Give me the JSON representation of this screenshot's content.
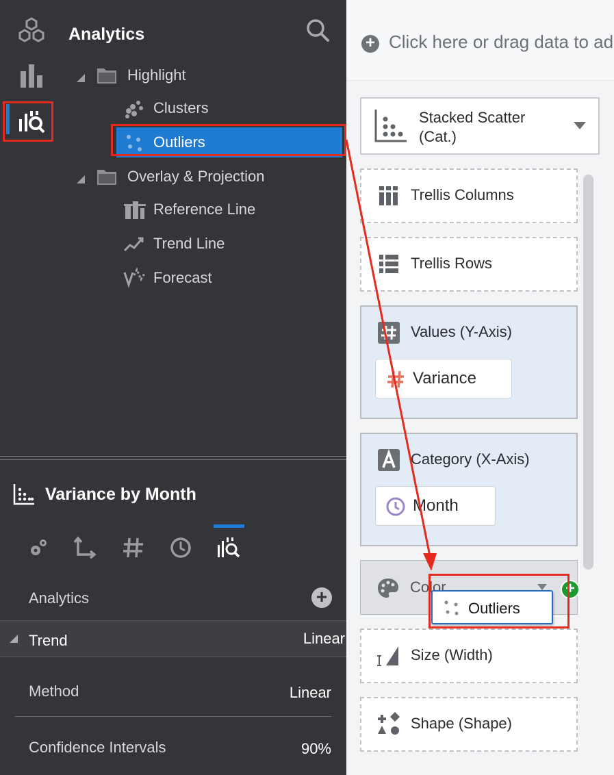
{
  "analytics_panel": {
    "title": "Analytics",
    "tree": [
      {
        "label": "Highlight",
        "type": "folder"
      },
      {
        "label": "Clusters",
        "type": "item"
      },
      {
        "label": "Outliers",
        "type": "item",
        "selected": true
      },
      {
        "label": "Overlay & Projection",
        "type": "folder"
      },
      {
        "label": "Reference Line",
        "type": "item"
      },
      {
        "label": "Trend Line",
        "type": "item"
      },
      {
        "label": "Forecast",
        "type": "item"
      }
    ]
  },
  "properties": {
    "viz_title": "Variance by Month",
    "section_label": "Analytics",
    "trend": {
      "label": "Trend",
      "value": "Linear"
    },
    "method": {
      "label": "Method",
      "value": "Linear"
    },
    "confidence": {
      "label": "Confidence Intervals",
      "value": "90%"
    }
  },
  "grammar": {
    "drop_prompt": "Click here or drag data to add",
    "chart_type": "Stacked Scatter\n(Cat.)",
    "trellis_columns": "Trellis Columns",
    "trellis_rows": "Trellis Rows",
    "values_axis": {
      "label": "Values (Y-Axis)",
      "pill": "Variance"
    },
    "category_axis": {
      "label": "Category (X-Axis)",
      "pill": "Month"
    },
    "color": {
      "label": "Color",
      "dragged_pill": "Outliers"
    },
    "size": "Size (Width)",
    "shape": "Shape (Shape)"
  },
  "colors": {
    "accent_blue": "#1e7bd1",
    "highlight_red": "#e52b1f",
    "add_green": "#1d9a2e",
    "dark_panel": "#333538"
  },
  "icons": {
    "rail": [
      "data-elements-icon",
      "visualizations-icon",
      "analytics-icon"
    ],
    "tabs": [
      "general-settings-icon",
      "axis-icon",
      "number-format-icon",
      "date-time-icon",
      "analytics-tab-icon"
    ]
  }
}
